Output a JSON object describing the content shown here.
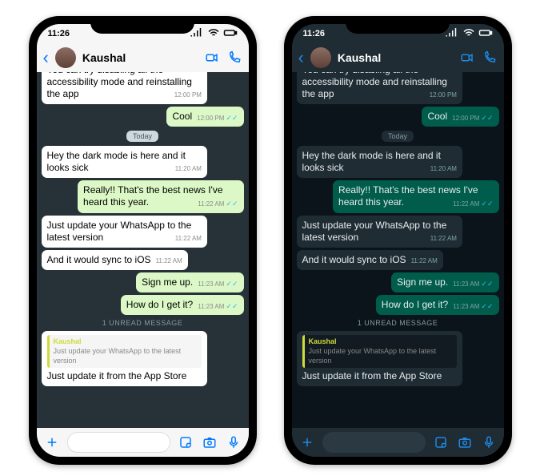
{
  "status": {
    "time": "11:26"
  },
  "header": {
    "contact_name": "Kaushal"
  },
  "light": {
    "messages": [
      {
        "dir": "in",
        "text": "You can try disabling all the accessibility mode and reinstalling the app",
        "time": "12:00 PM",
        "cut": true
      },
      {
        "dir": "out",
        "text": "Cool",
        "time": "12:00 PM",
        "ticks": true
      },
      {
        "chip": "Today"
      },
      {
        "dir": "in",
        "text": "Hey the dark mode is here and it looks sick",
        "time": "11:20 AM"
      },
      {
        "dir": "out",
        "text": "Really!! That's the best news I've heard this year.",
        "time": "11:22 AM",
        "ticks": true
      },
      {
        "dir": "in",
        "text": "Just update your WhatsApp to the latest version",
        "time": "11:22 AM"
      },
      {
        "dir": "in",
        "text": "And it would sync to iOS",
        "time": "11:22 AM"
      },
      {
        "dir": "out",
        "text": "Sign me up.",
        "time": "11:23 AM",
        "ticks": true
      },
      {
        "dir": "out",
        "text": "How do I get it?",
        "time": "11:23 AM",
        "ticks": true
      },
      {
        "unread": "1 UNREAD MESSAGE"
      },
      {
        "dir": "in",
        "reply": {
          "name": "Kaushal",
          "text": "Just update your WhatsApp to the latest version"
        },
        "text": "Just update it from the App Store",
        "time": ""
      }
    ]
  },
  "dark": {
    "messages": [
      {
        "dir": "in",
        "text": "You can try disabling all the accessibility mode and reinstalling the app",
        "time": "12:00 PM",
        "cut": true
      },
      {
        "dir": "out",
        "text": "Cool",
        "time": "12:00 PM",
        "ticks": true
      },
      {
        "chip": "Today"
      },
      {
        "dir": "in",
        "text": "Hey the dark mode is here and it looks sick",
        "time": "11:20 AM"
      },
      {
        "dir": "out",
        "text": "Really!! That's the best news I've heard this year.",
        "time": "11:22 AM",
        "ticks": true
      },
      {
        "dir": "in",
        "text": "Just update your WhatsApp to the latest version",
        "time": "11:22 AM"
      },
      {
        "dir": "in",
        "text": "And it would sync to iOS",
        "time": "11:22 AM"
      },
      {
        "dir": "out",
        "text": "Sign me up.",
        "time": "11:23 AM",
        "ticks": true
      },
      {
        "dir": "out",
        "text": "How do I get it?",
        "time": "11:23 AM",
        "ticks": true
      },
      {
        "unread": "1 UNREAD MESSAGE"
      },
      {
        "dir": "in",
        "reply": {
          "name": "Kaushal",
          "text": "Just update your WhatsApp to the latest version"
        },
        "text": "Just update it from the App Store",
        "time": ""
      }
    ]
  }
}
